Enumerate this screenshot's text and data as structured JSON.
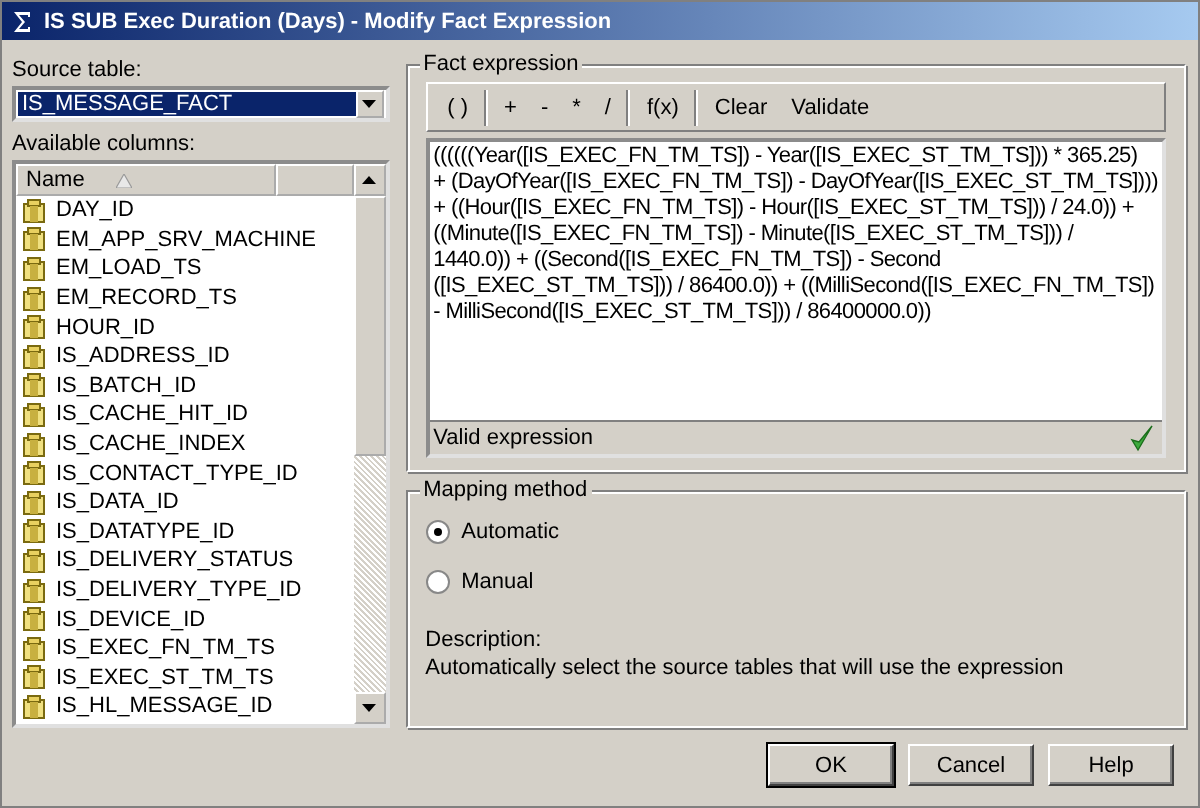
{
  "window": {
    "title": "IS SUB Exec Duration (Days) - Modify Fact Expression"
  },
  "source_table": {
    "label": "Source table:",
    "value": "IS_MESSAGE_FACT"
  },
  "available_columns": {
    "label": "Available columns:",
    "header": "Name",
    "items": [
      "DAY_ID",
      "EM_APP_SRV_MACHINE",
      "EM_LOAD_TS",
      "EM_RECORD_TS",
      "HOUR_ID",
      "IS_ADDRESS_ID",
      "IS_BATCH_ID",
      "IS_CACHE_HIT_ID",
      "IS_CACHE_INDEX",
      "IS_CONTACT_TYPE_ID",
      "IS_DATA_ID",
      "IS_DATATYPE_ID",
      "IS_DELIVERY_STATUS",
      "IS_DELIVERY_TYPE_ID",
      "IS_DEVICE_ID",
      "IS_EXEC_FN_TM_TS",
      "IS_EXEC_ST_TM_TS",
      "IS_HL_MESSAGE_ID"
    ]
  },
  "fact_expression": {
    "label": "Fact expression",
    "toolbar": [
      [
        "( )"
      ],
      [
        "+",
        "-",
        "*",
        "/"
      ],
      [
        "f(x)"
      ],
      [
        "Clear",
        "Validate"
      ]
    ],
    "lines": [
      "((((((Year([IS_EXEC_FN_TM_TS]) - Year([IS_EXEC_ST_TM_TS])) * 365.25)",
      "+ (DayOfYear([IS_EXEC_FN_TM_TS]) - DayOfYear([IS_EXEC_ST_TM_TS])))",
      "+ ((Hour([IS_EXEC_FN_TM_TS]) - Hour([IS_EXEC_ST_TM_TS])) / 24.0)) +",
      "((Minute([IS_EXEC_FN_TM_TS]) - Minute([IS_EXEC_ST_TM_TS])) /",
      "1440.0)) + ((Second([IS_EXEC_FN_TM_TS]) - Second",
      "([IS_EXEC_ST_TM_TS])) / 86400.0)) + ((MilliSecond([IS_EXEC_FN_TM_TS])",
      "- MilliSecond([IS_EXEC_ST_TM_TS])) / 86400000.0))"
    ],
    "status": "Valid expression",
    "valid": true
  },
  "mapping_method": {
    "label": "Mapping method",
    "options": [
      {
        "label": "Automatic",
        "selected": true
      },
      {
        "label": "Manual",
        "selected": false
      }
    ],
    "description_label": "Description:",
    "description": "Automatically select the source tables that will use the expression"
  },
  "buttons": [
    "OK",
    "Cancel",
    "Help"
  ]
}
